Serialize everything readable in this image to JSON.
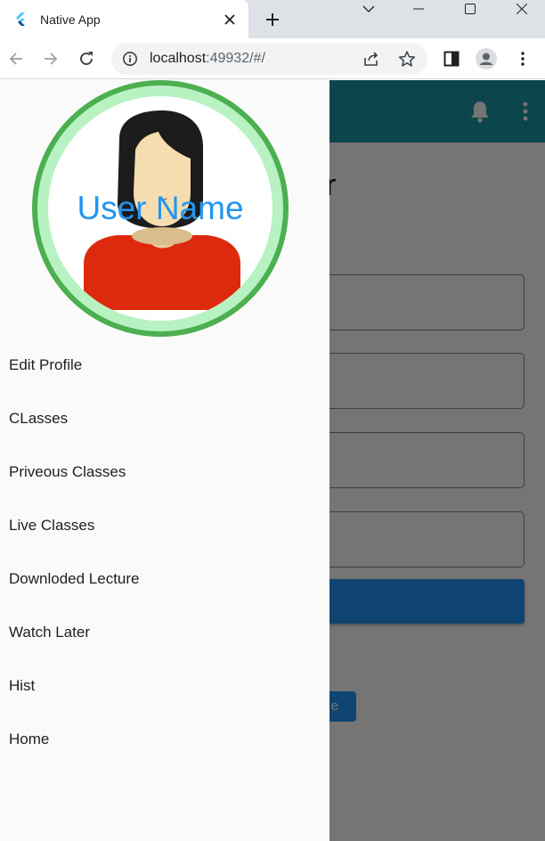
{
  "browser": {
    "tab_title": "Native App",
    "url_host": "localhost",
    "url_rest": ":49932/#/"
  },
  "colors": {
    "app_bar": "#1b9aa5",
    "primary_button": "#2196f3",
    "avatar_ring": "#4caf50",
    "avatar_name": "#2196f3"
  },
  "app_bar": {
    "icons": [
      "bell-icon",
      "more-vert-icon"
    ]
  },
  "page": {
    "heading_fragment": "ser",
    "small_button_fragment": "e"
  },
  "drawer": {
    "user_name": "User Name",
    "menu": [
      {
        "label": "Edit Profile"
      },
      {
        "label": "CLasses"
      },
      {
        "label": "Priveous Classes"
      },
      {
        "label": "Live Classes"
      },
      {
        "label": "Downloded Lecture"
      },
      {
        "label": "Watch Later"
      },
      {
        "label": "Hist"
      },
      {
        "label": "Home"
      }
    ]
  }
}
